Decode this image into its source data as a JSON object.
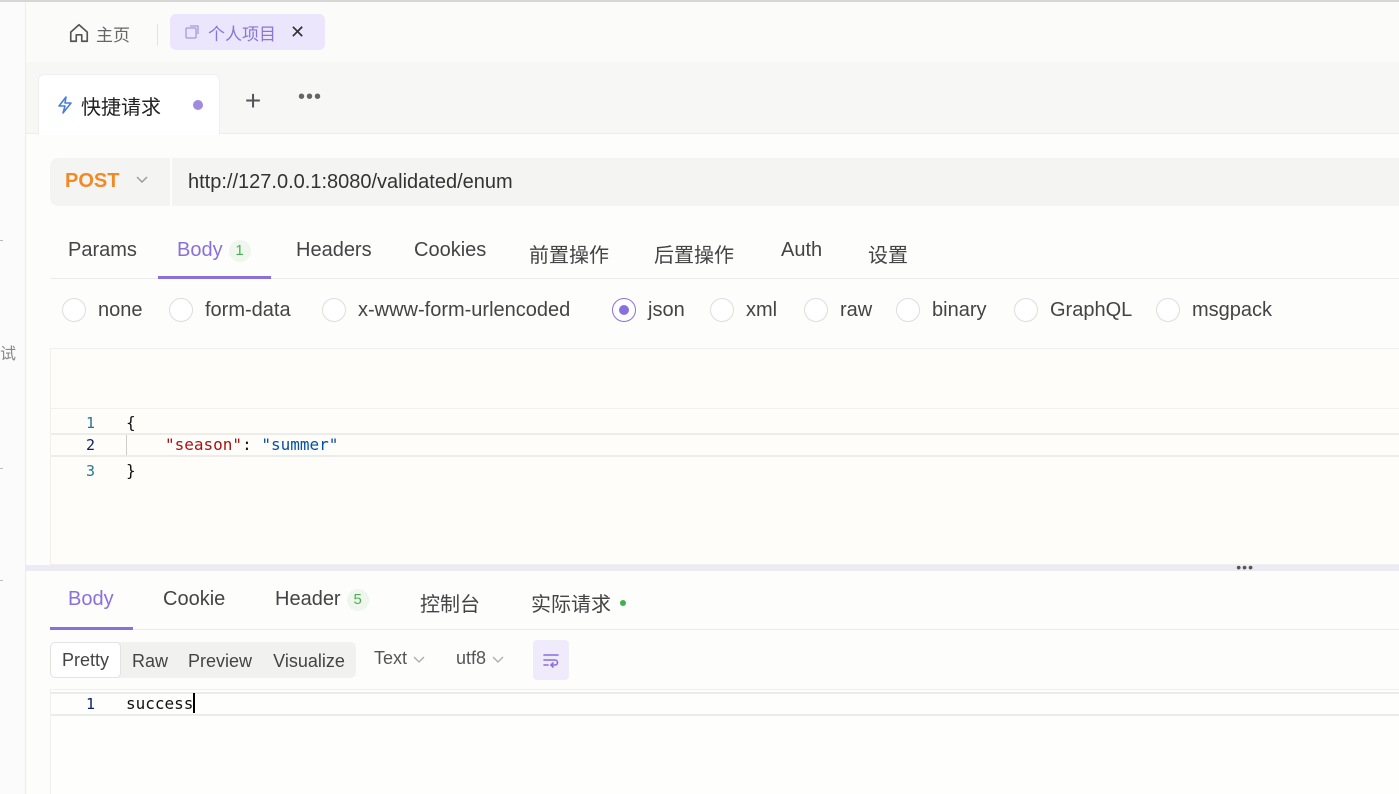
{
  "top_tabs": {
    "home_label": "主页",
    "project_label": "个人项目"
  },
  "left_strip": {
    "glyph": "试"
  },
  "request_tab": {
    "title": "快捷请求"
  },
  "url_bar": {
    "method": "POST",
    "url": "http://127.0.0.1:8080/validated/enum"
  },
  "request_tabs": [
    {
      "label": "Params"
    },
    {
      "label": "Body",
      "badge": "1"
    },
    {
      "label": "Headers"
    },
    {
      "label": "Cookies"
    },
    {
      "label": "前置操作"
    },
    {
      "label": "后置操作"
    },
    {
      "label": "Auth"
    },
    {
      "label": "设置"
    }
  ],
  "body_types": [
    {
      "label": "none",
      "selected": false
    },
    {
      "label": "form-data",
      "selected": false
    },
    {
      "label": "x-www-form-urlencoded",
      "selected": false
    },
    {
      "label": "json",
      "selected": true
    },
    {
      "label": "xml",
      "selected": false
    },
    {
      "label": "raw",
      "selected": false
    },
    {
      "label": "binary",
      "selected": false
    },
    {
      "label": "GraphQL",
      "selected": false
    },
    {
      "label": "msgpack",
      "selected": false
    }
  ],
  "request_body": {
    "line_numbers": [
      "1",
      "2",
      "3"
    ],
    "open_brace": "{",
    "key": "\"season\"",
    "colon": ": ",
    "value": "\"summer\"",
    "close_brace": "}"
  },
  "response_tabs": [
    {
      "label": "Body"
    },
    {
      "label": "Cookie"
    },
    {
      "label": "Header",
      "badge": "5"
    },
    {
      "label": "控制台"
    },
    {
      "label": "实际请求"
    }
  ],
  "response_view_modes": [
    "Pretty",
    "Raw",
    "Preview",
    "Visualize"
  ],
  "response_format": "Text",
  "response_encoding": "utf8",
  "response_body": {
    "line_number": "1",
    "text": "success"
  },
  "colors": {
    "accent": "#8b70dd",
    "method_post": "#f08a24",
    "badge_green": "#4caf50"
  }
}
